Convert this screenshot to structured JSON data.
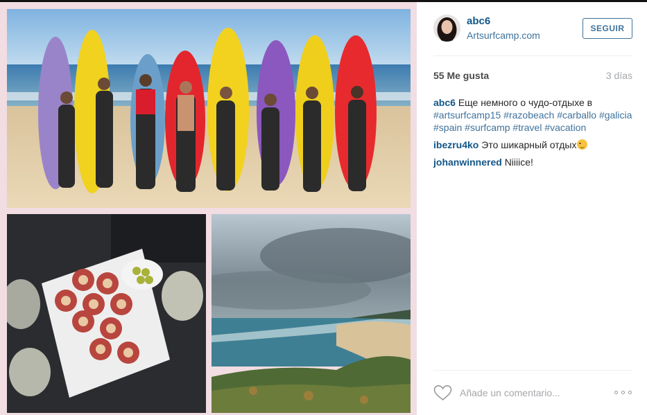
{
  "post": {
    "username": "abc6",
    "location": "Artsurfcamp.com",
    "follow_label": "SEGUIR",
    "likes": "55 Me gusta",
    "time_ago": "3 días"
  },
  "caption": {
    "user": "abc6",
    "text": "Еще немного о чудо-отдыхе в",
    "hashtags": [
      "#artsurfcamp15",
      "#razobeach",
      "#carballo",
      "#galicia",
      "#spain",
      "#surfcamp",
      "#travel",
      "#vacation"
    ]
  },
  "comments": [
    {
      "user": "ibezru4ko",
      "text": "Это шикарный отдых",
      "emoji": "winking-face"
    },
    {
      "user": "johanwinnered",
      "text": "Niiiice!"
    }
  ],
  "footer": {
    "comment_placeholder": "Añade un comentario..."
  },
  "icons": {
    "like": "heart-outline-icon",
    "more": "more-options-icon"
  },
  "colors": {
    "link": "#125688",
    "hashtag": "#3f729b",
    "collage_background": "#f1dde2"
  }
}
